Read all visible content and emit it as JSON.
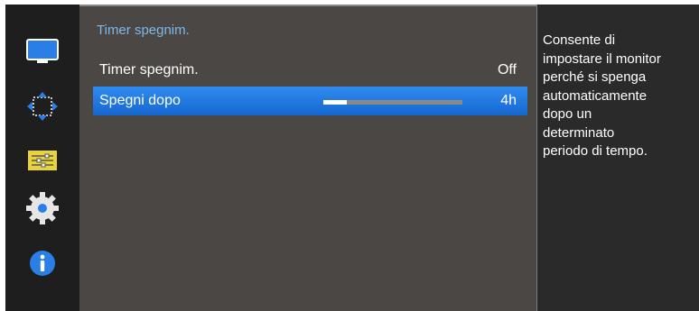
{
  "colors": {
    "accent": "#1f78e0",
    "title": "#7fb8ea",
    "panel": "#4b4744",
    "sidebar": "#1e1e1e",
    "info_panel": "#2a2a2a"
  },
  "sidebar": {
    "items": [
      {
        "icon": "monitor-icon"
      },
      {
        "icon": "resize-arrows-icon"
      },
      {
        "icon": "sliders-icon"
      },
      {
        "icon": "gear-icon"
      },
      {
        "icon": "info-icon"
      }
    ]
  },
  "menu": {
    "title": "Timer spegnim.",
    "rows": [
      {
        "label": "Timer spegnim.",
        "value": "Off"
      },
      {
        "label": "Spegni dopo",
        "value": "4h",
        "progress_fraction": 0.17
      }
    ]
  },
  "info": {
    "lines": [
      "Consente di",
      "impostare il monitor",
      "perché si spenga",
      "automaticamente",
      "dopo un",
      "determinato",
      "periodo di tempo."
    ]
  }
}
